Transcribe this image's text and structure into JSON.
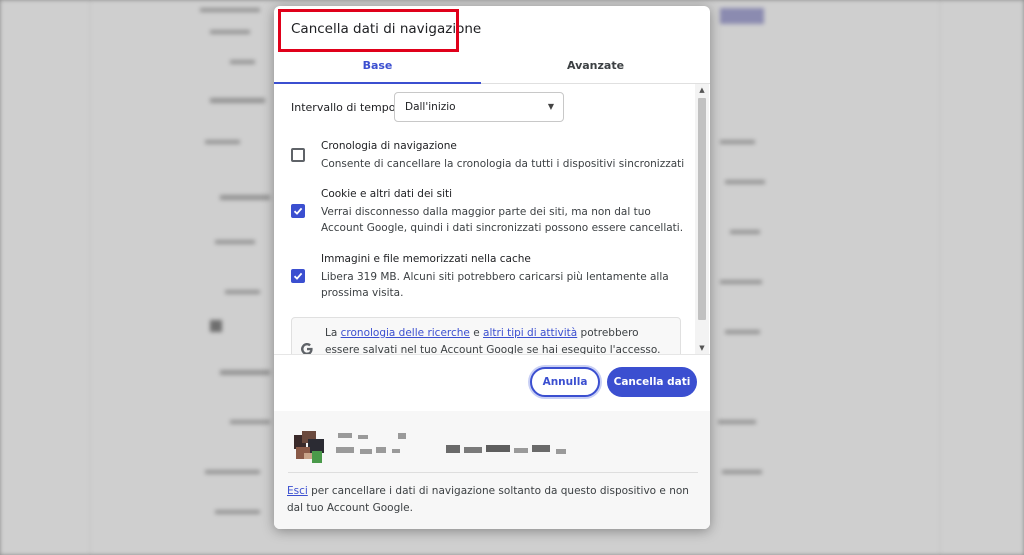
{
  "dialog": {
    "title": "Cancella dati di navigazione",
    "tabs": [
      {
        "label": "Base",
        "active": true
      },
      {
        "label": "Avanzate",
        "active": false
      }
    ],
    "time_range": {
      "label": "Intervallo di tempo",
      "selected": "Dall'inizio"
    },
    "options": [
      {
        "title": "Cronologia di navigazione",
        "description": "Consente di cancellare la cronologia da tutti i dispositivi sincronizzati",
        "checked": false
      },
      {
        "title": "Cookie e altri dati dei siti",
        "description": "Verrai disconnesso dalla maggior parte dei siti, ma non dal tuo Account Google, quindi i dati sincronizzati possono essere cancellati.",
        "checked": true
      },
      {
        "title": "Immagini e file memorizzati nella cache",
        "description": "Libera 319 MB. Alcuni siti potrebbero caricarsi più lentamente alla prossima visita.",
        "checked": true
      }
    ],
    "info": {
      "prefix": "La ",
      "link1": "cronologia delle ricerche",
      "middle": " e ",
      "link2": "altri tipi di attività",
      "suffix": " potrebbero essere salvati nel tuo Account Google se hai eseguito l'accesso. Puoi eliminarli"
    },
    "buttons": {
      "cancel": "Annulla",
      "confirm": "Cancella dati"
    },
    "signout_note": {
      "link": "Esci",
      "text": " per cancellare i dati di navigazione soltanto da questo dispositivo e non dal tuo Account Google."
    }
  },
  "colors": {
    "accent": "#3b4fd0",
    "highlight_border": "#e0001a"
  },
  "icons": [
    "chevron-down-icon",
    "checkmark-icon",
    "google-g-icon",
    "scroll-up-icon",
    "scroll-down-icon"
  ]
}
